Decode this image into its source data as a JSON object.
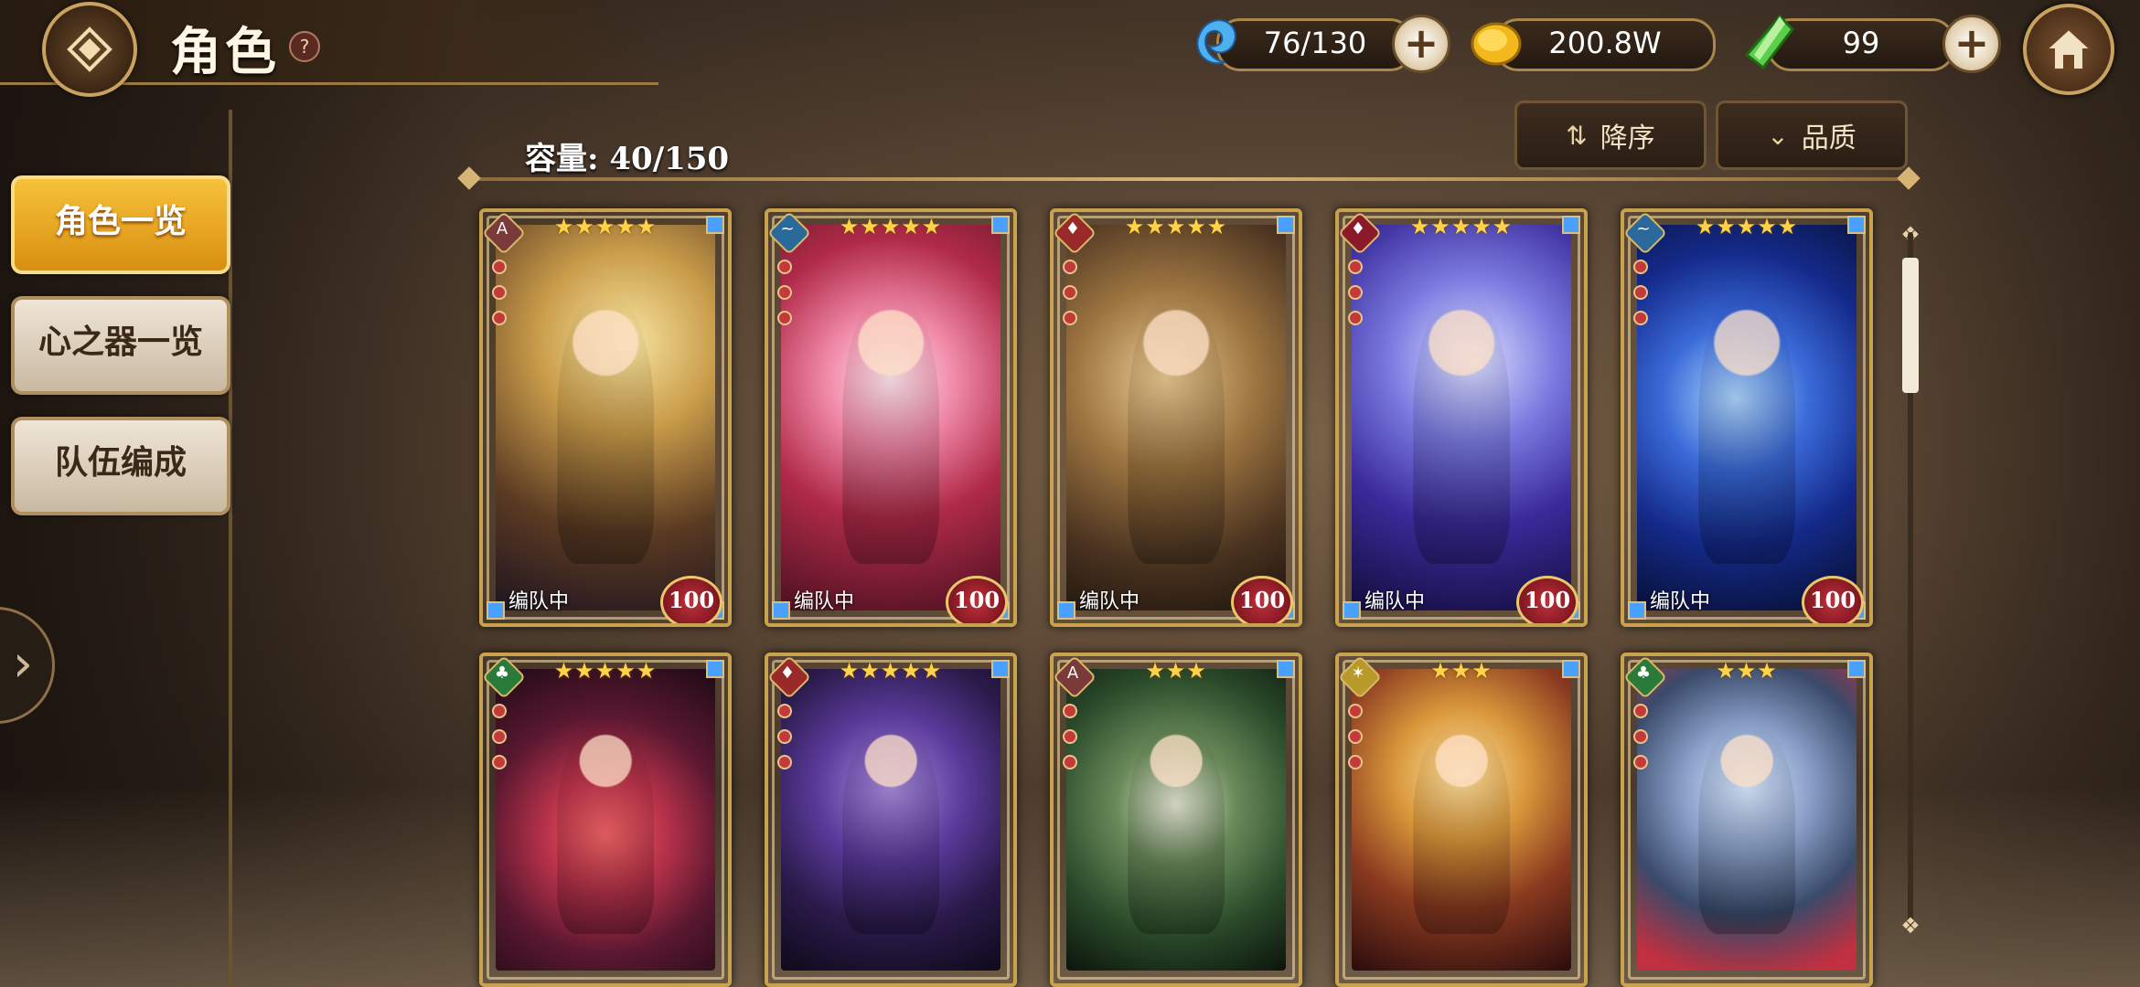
{
  "header": {
    "title": "角色",
    "help": "?"
  },
  "resources": {
    "stamina": {
      "value": "76/130",
      "icon": "blue-spirit-icon"
    },
    "gold": {
      "value": "200.8W",
      "icon": "gold-coin-icon"
    },
    "gems": {
      "value": "99",
      "icon": "green-crystal-icon"
    },
    "plus": "+"
  },
  "sort": {
    "order_label": "降序",
    "quality_label": "品质"
  },
  "capacity_text": "容量: 40/150",
  "sidebar": {
    "items": [
      {
        "label": "角色一览",
        "active": true
      },
      {
        "label": "心之器一览",
        "active": false
      },
      {
        "label": "队伍编成",
        "active": false
      }
    ],
    "expand": "›"
  },
  "cards": [
    {
      "stars": "★★★★★",
      "status": "编队中",
      "level": "100",
      "element": "A"
    },
    {
      "stars": "★★★★★",
      "status": "编队中",
      "level": "100",
      "element": "~"
    },
    {
      "stars": "★★★★★",
      "status": "编队中",
      "level": "100",
      "element": "♦"
    },
    {
      "stars": "★★★★★",
      "status": "编队中",
      "level": "100",
      "element": "♦"
    },
    {
      "stars": "★★★★★",
      "status": "编队中",
      "level": "100",
      "element": "~"
    },
    {
      "stars": "★★★★★",
      "status": "",
      "level": "",
      "element": "♣"
    },
    {
      "stars": "★★★★★",
      "status": "",
      "level": "",
      "element": "♦"
    },
    {
      "stars": "★★★",
      "status": "",
      "level": "",
      "element": "A"
    },
    {
      "stars": "★★★",
      "status": "",
      "level": "",
      "element": "✶"
    },
    {
      "stars": "★★★",
      "status": "",
      "level": "",
      "element": "♣"
    }
  ],
  "colors": {
    "accent_gold": "#c9a24e",
    "active_tab": "#f7c13a",
    "level_badge": "#c0303a"
  }
}
